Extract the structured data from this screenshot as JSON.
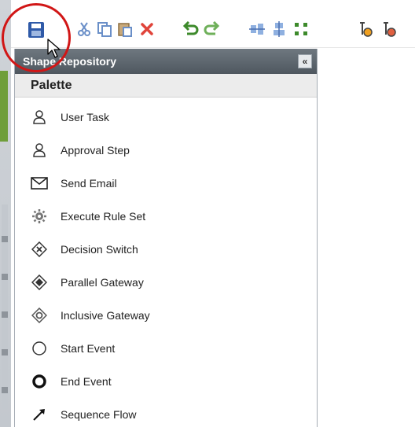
{
  "toolbar": {
    "buttons": [
      {
        "name": "save-button",
        "icon": "save-icon",
        "color": "#2f5aa8"
      },
      {
        "name": "cut-button",
        "icon": "cut-icon",
        "color": "#6a8fc8"
      },
      {
        "name": "copy-button",
        "icon": "copy-icon",
        "color": "#6a8fc8"
      },
      {
        "name": "paste-button",
        "icon": "paste-icon",
        "color": "#6a8fc8"
      },
      {
        "name": "delete-button",
        "icon": "delete-icon",
        "color": "#e0443a"
      },
      {
        "name": "undo-button",
        "icon": "undo-icon",
        "color": "#3d8a2b"
      },
      {
        "name": "redo-button",
        "icon": "redo-icon",
        "color": "#3d8a2b"
      },
      {
        "name": "align-vertical-button",
        "icon": "align-vertical-icon",
        "color": "#6a8fc8"
      },
      {
        "name": "align-horizontal-button",
        "icon": "align-horizontal-icon",
        "color": "#6a8fc8"
      },
      {
        "name": "group-button",
        "icon": "group-icon",
        "color": "#3d8a2b"
      },
      {
        "name": "add-shape-button",
        "icon": "add-shape-icon",
        "color": "#444444"
      },
      {
        "name": "remove-shape-button",
        "icon": "remove-shape-icon",
        "color": "#444444"
      }
    ]
  },
  "shape_repository": {
    "title": "Shape Repository",
    "collapse_label": "«"
  },
  "palette": {
    "title": "Palette",
    "items": [
      {
        "label": "User Task",
        "icon": "user-icon"
      },
      {
        "label": "Approval Step",
        "icon": "user-icon"
      },
      {
        "label": "Send Email",
        "icon": "envelope-icon"
      },
      {
        "label": "Execute Rule Set",
        "icon": "gear-icon"
      },
      {
        "label": "Decision Switch",
        "icon": "diamond-x-icon"
      },
      {
        "label": "Parallel Gateway",
        "icon": "diamond-plus-icon"
      },
      {
        "label": "Inclusive Gateway",
        "icon": "diamond-circle-icon"
      },
      {
        "label": "Start Event",
        "icon": "circle-thin-icon"
      },
      {
        "label": "End Event",
        "icon": "circle-thick-icon"
      },
      {
        "label": "Sequence Flow",
        "icon": "arrow-icon"
      }
    ]
  },
  "colors": {
    "highlight_circle": "#d11616",
    "panel_header": "#5a6269"
  }
}
